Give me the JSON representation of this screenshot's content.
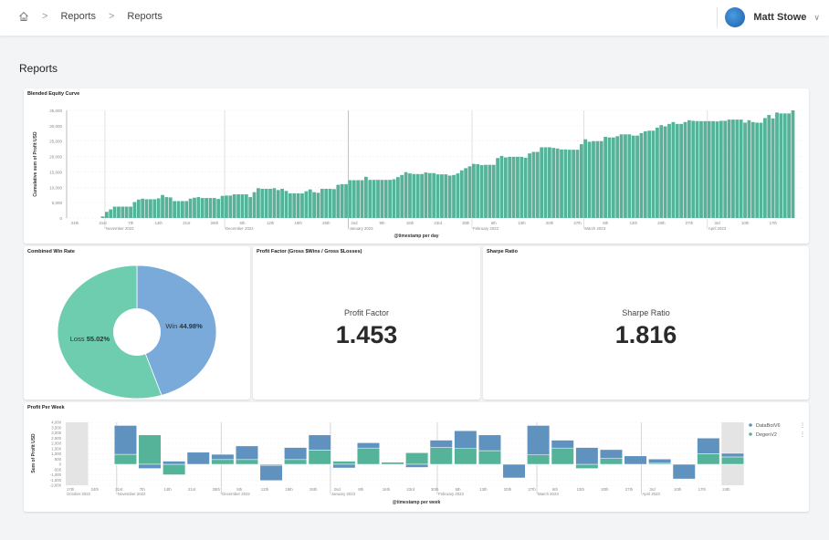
{
  "header": {
    "breadcrumbs": [
      "Reports",
      "Reports"
    ],
    "user_name": "Matt Stowe"
  },
  "page": {
    "title": "Reports"
  },
  "colors": {
    "green": "#54b399",
    "blue": "#6092c0",
    "pie_win": "#7aaad9",
    "pie_loss": "#6dcdae"
  },
  "chart_data": [
    {
      "type": "bar",
      "title": "Blended Equity Curve",
      "xlabel": "@timestamp per day",
      "ylabel": "Cumulative sum of Profit USD",
      "ylim": [
        0,
        35000
      ],
      "yticks": [
        "0",
        "5,000",
        "10,000",
        "15,000",
        "20,000",
        "25,000",
        "30,000",
        "35,000"
      ],
      "start_date": "2022-10-24",
      "grid": true,
      "xticks": [
        "24th",
        "31st",
        "7th",
        "14th",
        "21st",
        "28th",
        "5th",
        "12th",
        "19th",
        "26th",
        "2nd",
        "9th",
        "16th",
        "23rd",
        "30th",
        "6th",
        "13th",
        "20th",
        "27th",
        "6th",
        "13th",
        "20th",
        "27th",
        "3rd",
        "10th",
        "17th"
      ],
      "months": [
        "November 2022",
        "December 2022",
        "January 2023",
        "February 2023",
        "March 2023",
        "April 2023"
      ],
      "values": [
        0,
        0,
        0,
        0,
        0,
        0,
        0,
        500,
        2000,
        2800,
        3700,
        3700,
        3700,
        3700,
        3700,
        5200,
        6000,
        6300,
        6100,
        6100,
        6100,
        6400,
        7500,
        6800,
        6700,
        5500,
        5500,
        5500,
        5500,
        6300,
        6600,
        6800,
        6500,
        6500,
        6500,
        6500,
        6200,
        7200,
        7300,
        7300,
        7700,
        7700,
        7700,
        7700,
        6800,
        8400,
        9700,
        9500,
        9500,
        9500,
        9700,
        9100,
        9500,
        8800,
        8000,
        8000,
        8000,
        8000,
        8700,
        9300,
        8400,
        8200,
        9500,
        9500,
        9500,
        9400,
        10800,
        11000,
        11000,
        12300,
        12300,
        12300,
        12300,
        13400,
        12400,
        12400,
        12400,
        12400,
        12400,
        12400,
        12600,
        13300,
        14000,
        14900,
        14500,
        14300,
        14300,
        14300,
        14800,
        14600,
        14600,
        14200,
        14200,
        14200,
        13800,
        14000,
        14500,
        15500,
        16200,
        16800,
        17600,
        17500,
        17200,
        17300,
        17300,
        17300,
        19500,
        20200,
        19700,
        19900,
        19900,
        19900,
        19900,
        19600,
        21000,
        21500,
        21500,
        23000,
        23000,
        23000,
        22800,
        22600,
        22300,
        22300,
        22200,
        22200,
        22200,
        24000,
        25600,
        24800,
        25000,
        25000,
        25000,
        26400,
        26200,
        26200,
        26600,
        27200,
        27200,
        27200,
        26800,
        26800,
        27600,
        28200,
        28400,
        28400,
        29400,
        30200,
        29800,
        30600,
        31200,
        30600,
        30600,
        31200,
        31800,
        31600,
        31500,
        31500,
        31500,
        31500,
        31500,
        31400,
        31600,
        31600,
        32000,
        32000,
        32000,
        32000,
        31000,
        31800,
        31200,
        31000,
        31000,
        32500,
        33500,
        32400,
        34300,
        34000,
        34000,
        34000,
        35000
      ]
    },
    {
      "type": "pie",
      "title": "Combined Win Rate",
      "slices": [
        {
          "label": "Win",
          "value": 44.98,
          "display": "44.98%"
        },
        {
          "label": "Loss",
          "value": 55.02,
          "display": "55.02%"
        }
      ]
    },
    {
      "type": "bar",
      "stacked": true,
      "title": "Profit Per Week",
      "xlabel": "@timestamp per week",
      "ylabel": "Sum of Profit USD",
      "ylim": [
        -2000,
        4000
      ],
      "yticks": [
        "-2,000",
        "-1,500",
        "-1,000",
        "-500",
        "0",
        "500",
        "1,000",
        "1,500",
        "2,000",
        "2,500",
        "3,000",
        "3,500",
        "4,000"
      ],
      "xticks": [
        "17th",
        "24th",
        "31st",
        "7th",
        "14th",
        "21st",
        "28th",
        "5th",
        "12th",
        "19th",
        "26th",
        "2nd",
        "9th",
        "16th",
        "23rd",
        "30th",
        "6th",
        "13th",
        "20th",
        "27th",
        "6th",
        "13th",
        "20th",
        "27th",
        "3rd",
        "10th",
        "17th",
        "24th"
      ],
      "months": [
        "October 2022",
        "November 2022",
        "December 2022",
        "January 2023",
        "February 2023",
        "March 2023",
        "April 2023"
      ],
      "legend_position": "right",
      "series": [
        {
          "name": "DataBotV6",
          "values": [
            0,
            0,
            2750,
            -400,
            300,
            1150,
            500,
            1300,
            -1450,
            1150,
            1450,
            -350,
            500,
            0,
            -300,
            700,
            1700,
            1500,
            -1300,
            2800,
            750,
            1600,
            850,
            800,
            400,
            -1400,
            1500,
            350
          ]
        },
        {
          "name": "DegenV2",
          "values": [
            0,
            0,
            950,
            2800,
            -1000,
            0,
            450,
            450,
            -100,
            450,
            1350,
            300,
            1550,
            200,
            1100,
            1600,
            1500,
            1300,
            0,
            900,
            1550,
            -400,
            550,
            0,
            100,
            0,
            1000,
            700
          ]
        }
      ]
    }
  ],
  "metrics": {
    "profit_factor": {
      "title": "Profit Factor (Gross $Wins / Gross $Losses)",
      "label": "Profit Factor",
      "value": "1.453"
    },
    "sharpe": {
      "title": "Sharpe Ratio",
      "label": "Sharpe Ratio",
      "value": "1.816"
    }
  }
}
